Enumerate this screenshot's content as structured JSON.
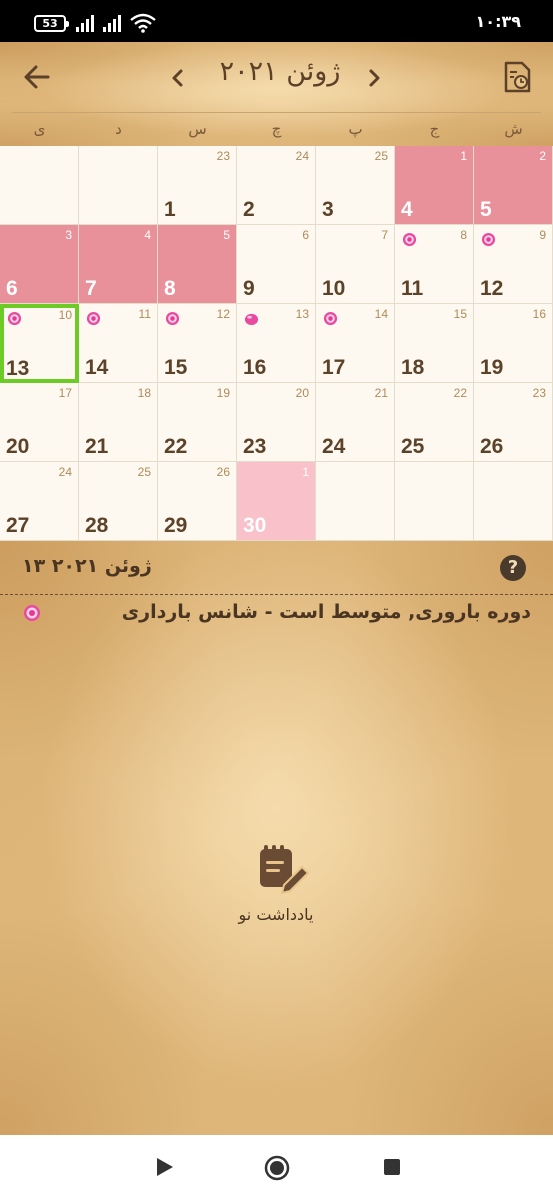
{
  "status_bar": {
    "battery": "53",
    "time": "۱۰:۳۹"
  },
  "header": {
    "month_title": "ژوئن ۲۰۲۱",
    "weekdays": [
      "ش",
      "ج",
      "پ",
      "چ",
      "س",
      "د",
      "ی"
    ]
  },
  "calendar": {
    "weeks": [
      [
        {
          "day": "5",
          "cycle": "2",
          "state": "period"
        },
        {
          "day": "4",
          "cycle": "1",
          "state": "period"
        },
        {
          "day": "3",
          "cycle": "25",
          "state": ""
        },
        {
          "day": "2",
          "cycle": "24",
          "state": ""
        },
        {
          "day": "1",
          "cycle": "23",
          "state": ""
        },
        {
          "day": "",
          "cycle": "",
          "state": ""
        },
        {
          "day": "",
          "cycle": "",
          "state": ""
        }
      ],
      [
        {
          "day": "12",
          "cycle": "9",
          "state": "",
          "icon": "fertility-flower-icon"
        },
        {
          "day": "11",
          "cycle": "8",
          "state": "",
          "icon": "fertility-flower-icon"
        },
        {
          "day": "10",
          "cycle": "7",
          "state": ""
        },
        {
          "day": "9",
          "cycle": "6",
          "state": ""
        },
        {
          "day": "8",
          "cycle": "5",
          "state": "period"
        },
        {
          "day": "7",
          "cycle": "4",
          "state": "period"
        },
        {
          "day": "6",
          "cycle": "3",
          "state": "period"
        }
      ],
      [
        {
          "day": "19",
          "cycle": "16",
          "state": ""
        },
        {
          "day": "18",
          "cycle": "15",
          "state": ""
        },
        {
          "day": "17",
          "cycle": "14",
          "state": "",
          "icon": "fertility-flower-icon"
        },
        {
          "day": "16",
          "cycle": "13",
          "state": "",
          "icon": "ovulation-egg-icon"
        },
        {
          "day": "15",
          "cycle": "12",
          "state": "",
          "icon": "fertility-flower-icon"
        },
        {
          "day": "14",
          "cycle": "11",
          "state": "",
          "icon": "fertility-flower-icon"
        },
        {
          "day": "13",
          "cycle": "10",
          "state": "today",
          "icon": "fertility-flower-icon"
        }
      ],
      [
        {
          "day": "26",
          "cycle": "23",
          "state": ""
        },
        {
          "day": "25",
          "cycle": "22",
          "state": ""
        },
        {
          "day": "24",
          "cycle": "21",
          "state": ""
        },
        {
          "day": "23",
          "cycle": "20",
          "state": ""
        },
        {
          "day": "22",
          "cycle": "19",
          "state": ""
        },
        {
          "day": "21",
          "cycle": "18",
          "state": ""
        },
        {
          "day": "20",
          "cycle": "17",
          "state": ""
        }
      ],
      [
        {
          "day": "",
          "cycle": "",
          "state": ""
        },
        {
          "day": "",
          "cycle": "",
          "state": ""
        },
        {
          "day": "",
          "cycle": "",
          "state": ""
        },
        {
          "day": "30",
          "cycle": "1",
          "state": "predicted"
        },
        {
          "day": "29",
          "cycle": "26",
          "state": ""
        },
        {
          "day": "28",
          "cycle": "25",
          "state": ""
        },
        {
          "day": "27",
          "cycle": "24",
          "state": ""
        }
      ]
    ]
  },
  "details": {
    "selected_date": "۱۳ ژوئن ۲۰۲۱",
    "help_label": "?",
    "status_text": "دوره باروری, متوسط است - شانس بارداری",
    "new_note_label": "یادداشت نو"
  },
  "colors": {
    "period": "#e8919a",
    "predicted": "#f9c1c9",
    "today_border": "#6ccc25",
    "leather": "#e8c48a",
    "text_brown": "#4a3422"
  }
}
